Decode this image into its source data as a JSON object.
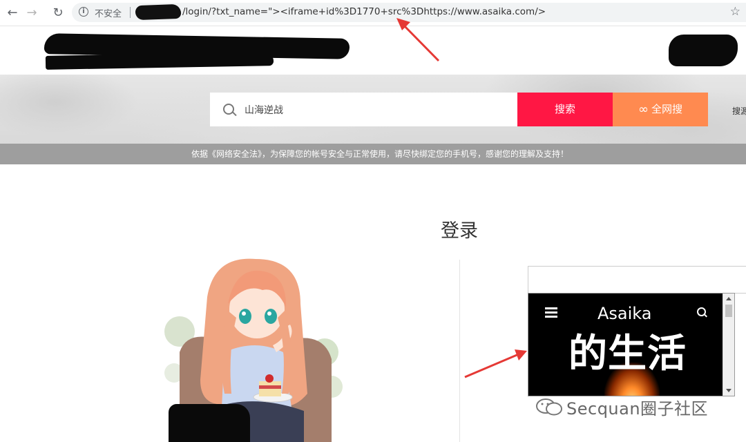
{
  "browser": {
    "security_label": "不安全",
    "url_path": "/login/?txt_name=\"><iframe+id%3D1770+src%3Dhttps://www.asaika.com/>"
  },
  "search": {
    "query": "山海逆战",
    "search_button": "搜索",
    "all_web_button": "全网搜",
    "side_link": "搜源"
  },
  "notice": {
    "text": "依据《网络安全法》，为保障您的帐号安全与正常使用，请尽快绑定您的手机号，感谢您的理解及支持！"
  },
  "login": {
    "title": "登录"
  },
  "iframe": {
    "site_name": "Asaika",
    "headline": "的生活"
  },
  "watermark": {
    "text": "Secquan圈子社区"
  },
  "colors": {
    "search_button": "#ff1744",
    "all_web_button": "#ff8a50",
    "notice_bg": "#9e9e9e",
    "arrow": "#e53935"
  }
}
